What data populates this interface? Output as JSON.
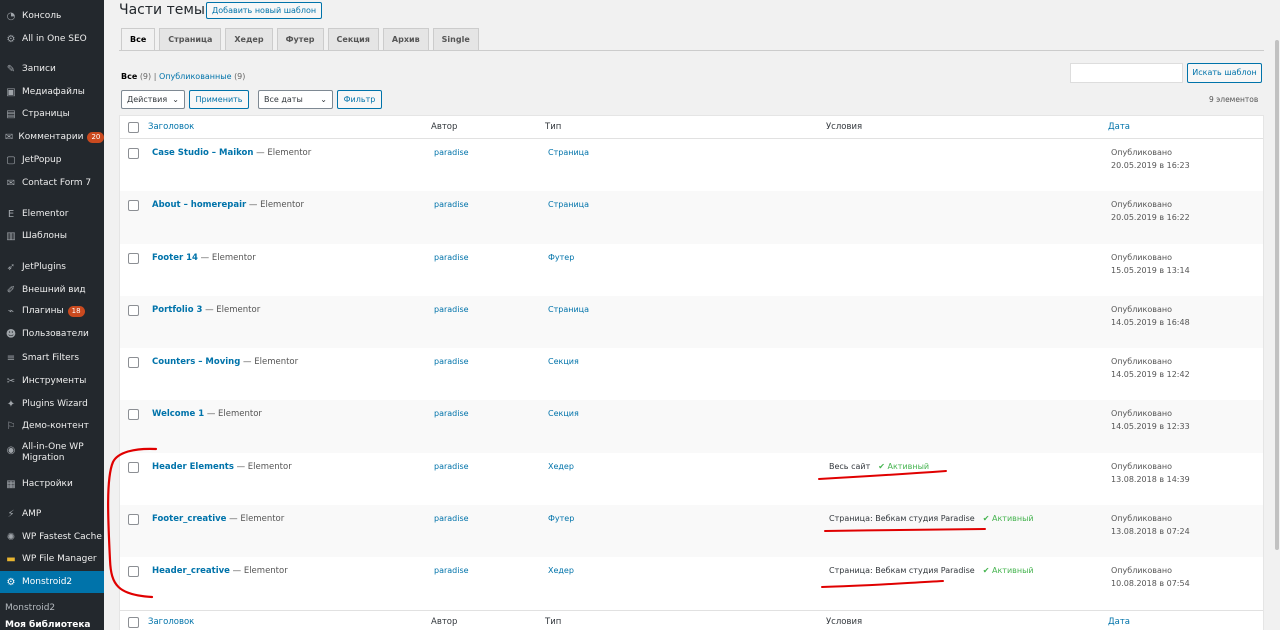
{
  "sidebar": {
    "items": [
      {
        "label": "Консоль",
        "icon": "dashboard-icon"
      },
      {
        "label": "All in One SEO",
        "icon": "gear-icon"
      },
      {
        "label": "Записи",
        "icon": "pin-icon"
      },
      {
        "label": "Медиафайлы",
        "icon": "media-icon"
      },
      {
        "label": "Страницы",
        "icon": "pages-icon"
      },
      {
        "label": "Комментарии",
        "icon": "comment-icon",
        "badge": "20"
      },
      {
        "label": "JetPopup",
        "icon": "popup-icon"
      },
      {
        "label": "Contact Form 7",
        "icon": "mail-icon"
      },
      {
        "label": "Elementor",
        "icon": "elementor-icon"
      },
      {
        "label": "Шаблоны",
        "icon": "folder-icon"
      },
      {
        "label": "JetPlugins",
        "icon": "rocket-icon"
      },
      {
        "label": "Внешний вид",
        "icon": "brush-icon"
      },
      {
        "label": "Плагины",
        "icon": "plugin-icon",
        "badge": "18"
      },
      {
        "label": "Пользователи",
        "icon": "user-icon"
      },
      {
        "label": "Smart Filters",
        "icon": "filter-icon"
      },
      {
        "label": "Инструменты",
        "icon": "wrench-icon"
      },
      {
        "label": "Plugins Wizard",
        "icon": "wizard-icon"
      },
      {
        "label": "Демо-контент",
        "icon": "demo-icon"
      },
      {
        "label": "All-in-One WP Migration",
        "icon": "migration-icon"
      },
      {
        "label": "Настройки",
        "icon": "settings-icon"
      },
      {
        "label": "AMP",
        "icon": "amp-icon"
      },
      {
        "label": "WP Fastest Cache",
        "icon": "cache-icon"
      },
      {
        "label": "WP File Manager",
        "icon": "file-manager-icon"
      },
      {
        "label": "Monstroid2",
        "icon": "gear-icon"
      }
    ],
    "submenu": [
      {
        "label": "Monstroid2"
      },
      {
        "label": "Моя библиотека"
      }
    ]
  },
  "header": {
    "title": "Части темы",
    "add_button": "Добавить новый шаблон"
  },
  "tabs": [
    "Все",
    "Страница",
    "Хедер",
    "Футер",
    "Секция",
    "Архив",
    "Single"
  ],
  "views": {
    "all": "Все",
    "all_count": "(9)",
    "separator": "|",
    "published": "Опубликованные",
    "published_count": "(9)"
  },
  "search": {
    "button": "Искать шаблон",
    "placeholder": ""
  },
  "filters": {
    "bulk": "Действия",
    "apply": "Применить",
    "dates": "Все даты",
    "filter": "Фильтр",
    "count": "9 элементов"
  },
  "table": {
    "columns": {
      "title": "Заголовок",
      "author": "Автор",
      "type": "Тип",
      "conditions": "Условия",
      "date": "Дата"
    },
    "rows": [
      {
        "title": "Case Studio – Maikon",
        "suffix": "— Elementor",
        "author": "paradise",
        "type": "Страница",
        "condition": "",
        "status": "",
        "date_status": "Опубликовано",
        "date": "20.05.2019 в 16:23"
      },
      {
        "title": "About – homerepair",
        "suffix": "— Elementor",
        "author": "paradise",
        "type": "Страница",
        "condition": "",
        "status": "",
        "date_status": "Опубликовано",
        "date": "20.05.2019 в 16:22"
      },
      {
        "title": "Footer 14",
        "suffix": "— Elementor",
        "author": "paradise",
        "type": "Футер",
        "condition": "",
        "status": "",
        "date_status": "Опубликовано",
        "date": "15.05.2019 в 13:14"
      },
      {
        "title": "Portfolio 3",
        "suffix": "— Elementor",
        "author": "paradise",
        "type": "Страница",
        "condition": "",
        "status": "",
        "date_status": "Опубликовано",
        "date": "14.05.2019 в 16:48"
      },
      {
        "title": "Counters – Moving",
        "suffix": "— Elementor",
        "author": "paradise",
        "type": "Секция",
        "condition": "",
        "status": "",
        "date_status": "Опубликовано",
        "date": "14.05.2019 в 12:42"
      },
      {
        "title": "Welcome 1",
        "suffix": "— Elementor",
        "author": "paradise",
        "type": "Секция",
        "condition": "",
        "status": "",
        "date_status": "Опубликовано",
        "date": "14.05.2019 в 12:33"
      },
      {
        "title": "Header Elements",
        "suffix": "— Elementor",
        "author": "paradise",
        "type": "Хедер",
        "condition": "Весь сайт",
        "status": "✔ Активный",
        "date_status": "Опубликовано",
        "date": "13.08.2018 в 14:39"
      },
      {
        "title": "Footer_creative",
        "suffix": "— Elementor",
        "author": "paradise",
        "type": "Футер",
        "condition": "Страница: Вебкам студия Paradise",
        "status": "✔ Активный",
        "date_status": "Опубликовано",
        "date": "13.08.2018 в 07:24"
      },
      {
        "title": "Header_creative",
        "suffix": "— Elementor",
        "author": "paradise",
        "type": "Хедер",
        "condition": "Страница: Вебкам студия Paradise",
        "status": "✔ Активный",
        "date_status": "Опубликовано",
        "date": "10.08.2018 в 07:54"
      }
    ]
  },
  "colors": {
    "sidebar_bg": "#23282d",
    "accent": "#0073aa",
    "active_green": "#46b450",
    "annotation_red": "#e00000"
  }
}
